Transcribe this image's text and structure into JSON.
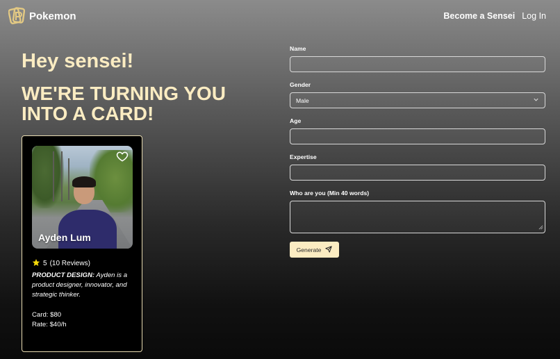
{
  "header": {
    "brand": "Pokemon",
    "nav": {
      "become_sensei": "Become a Sensei",
      "login": "Log In"
    }
  },
  "hero": {
    "greeting": "Hey sensei!",
    "headline_line1": "WE'RE TURNING YOU",
    "headline_line2": "INTO A CARD!"
  },
  "card": {
    "name": "Ayden Lum",
    "rating": "5",
    "reviews": "(10 Reviews)",
    "expertise_label": "PRODUCT DESIGN:",
    "description": " Ayden is a product designer, innovator, and strategic thinker.",
    "card_price": "Card: $80",
    "rate": "Rate: $40/h",
    "icons": {
      "favorite": "heart-icon",
      "star": "star-icon"
    },
    "colors": {
      "accent": "#fbecc2",
      "star": "#f5d90a",
      "border": "#e9dcb2"
    }
  },
  "form": {
    "name_label": "Name",
    "name_value": "",
    "gender_label": "Gender",
    "gender_value": "Male",
    "age_label": "Age",
    "age_value": "",
    "expertise_label": "Expertise",
    "expertise_value": "",
    "about_label": "Who are you (Min 40 words)",
    "about_value": "",
    "generate_label": "Generate",
    "icons": {
      "dropdown": "chevron-down-icon",
      "generate": "send-icon"
    }
  }
}
